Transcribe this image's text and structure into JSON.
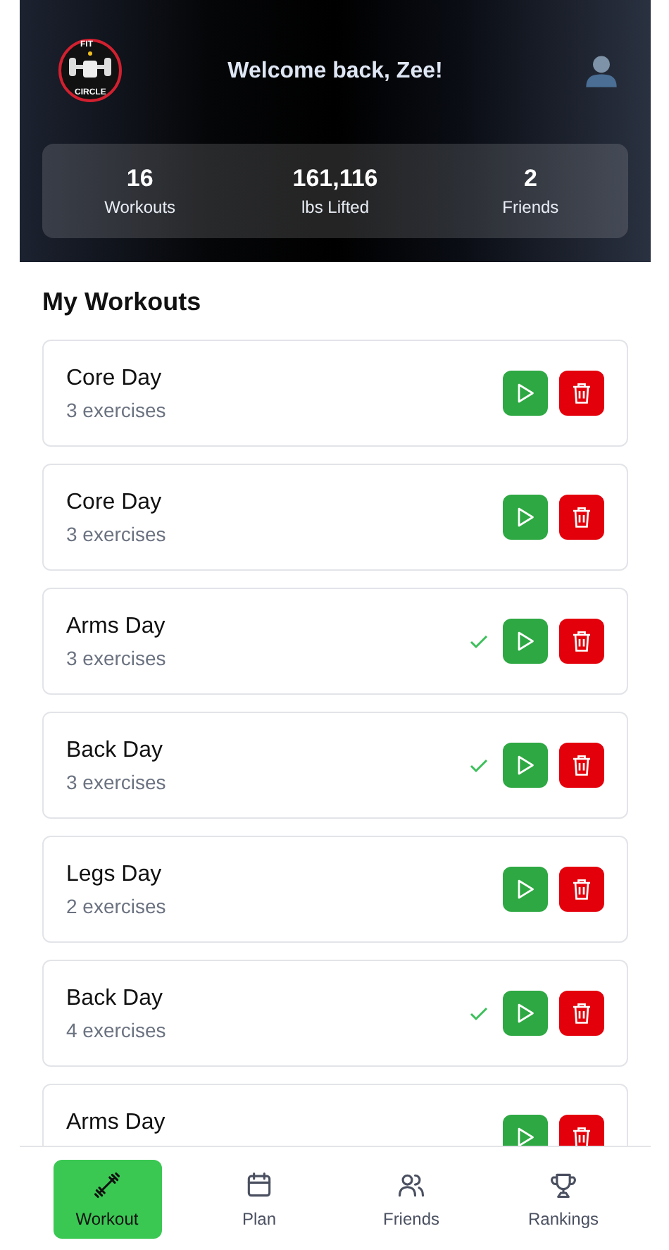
{
  "header": {
    "title": "Welcome back, Zee!",
    "logo": {
      "top_text": "FIT",
      "bottom_text": "CIRCLE"
    }
  },
  "stats": [
    {
      "value": "16",
      "label": "Workouts"
    },
    {
      "value": "161,116",
      "label": "lbs Lifted"
    },
    {
      "value": "2",
      "label": "Friends"
    }
  ],
  "section_title": "My Workouts",
  "workouts": [
    {
      "name": "Core Day",
      "exercises": "3 exercises",
      "completed": false
    },
    {
      "name": "Core Day",
      "exercises": "3 exercises",
      "completed": false
    },
    {
      "name": "Arms Day",
      "exercises": "3 exercises",
      "completed": true
    },
    {
      "name": "Back Day",
      "exercises": "3 exercises",
      "completed": true
    },
    {
      "name": "Legs Day",
      "exercises": "2 exercises",
      "completed": false
    },
    {
      "name": "Back Day",
      "exercises": "4 exercises",
      "completed": true
    },
    {
      "name": "Arms Day",
      "completed": false
    }
  ],
  "nav": [
    {
      "label": "Workout",
      "selected": true
    },
    {
      "label": "Plan",
      "selected": false
    },
    {
      "label": "Friends",
      "selected": false
    },
    {
      "label": "Rankings",
      "selected": false
    }
  ]
}
